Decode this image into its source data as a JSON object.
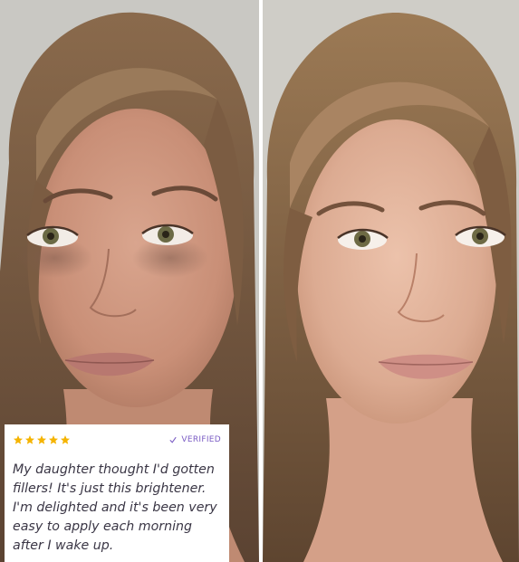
{
  "review": {
    "rating": 5,
    "rating_max": 5,
    "badge_label": "VERIFIED",
    "text": "My daughter thought I'd gotten fillers! It's just this brightener. I'm delighted and it's been very easy to apply each morning after I wake up.",
    "star_color": "#f5b400",
    "badge_color": "#7a5cc4"
  },
  "icons": {
    "star": "star-icon",
    "badge": "check-icon"
  }
}
